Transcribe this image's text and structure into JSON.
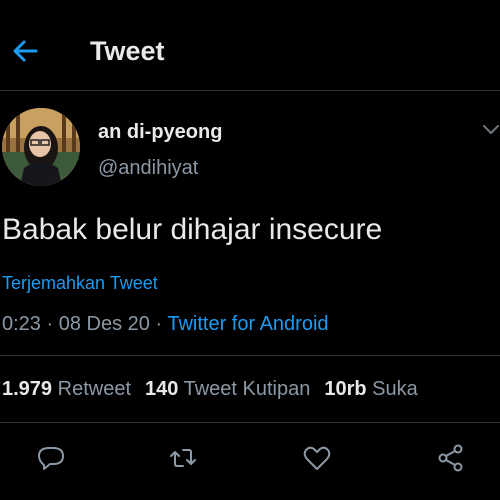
{
  "header": {
    "title": "Tweet"
  },
  "tweet": {
    "display_name": "an di-pyeong",
    "handle": "@andihiyat",
    "text": "Babak belur dihajar insecure",
    "translate_label": "Terjemahkan Tweet",
    "time": "0:23",
    "date": "08 Des 20",
    "source": "Twitter for Android",
    "separator": "·"
  },
  "stats": {
    "retweets_count": "1.979",
    "retweets_label": "Retweet",
    "quotes_count": "140",
    "quotes_label": "Tweet Kutipan",
    "likes_count": "10rb",
    "likes_label": "Suka"
  },
  "icons": {
    "back": "arrow-left-icon",
    "more": "chevron-down-icon",
    "reply": "reply-icon",
    "retweet": "retweet-icon",
    "like": "heart-icon",
    "share": "share-icon"
  },
  "colors": {
    "accent": "#1d9bf0",
    "background": "#000000",
    "muted": "#8b98a5"
  }
}
